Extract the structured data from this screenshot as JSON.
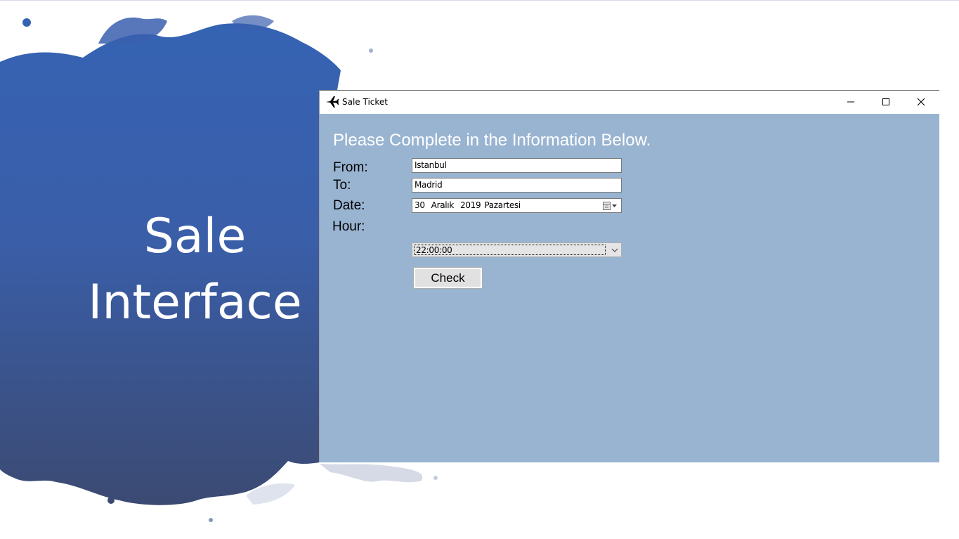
{
  "slide": {
    "title_line1": "Sale",
    "title_line2": "Interface"
  },
  "window": {
    "title": "Sale Ticket",
    "icon": "airplane-icon",
    "controls": [
      "minimize-icon",
      "maximize-icon",
      "close-icon"
    ]
  },
  "form": {
    "heading": "Please Complete in the Information Below.",
    "from_label": "From:",
    "from_value": "Istanbul",
    "to_label": "To:",
    "to_value": "Madrid",
    "date_label": "Date:",
    "date_day": "30",
    "date_month": "Aralık",
    "date_year": "2019",
    "date_weekday": "Pazartesi",
    "hour_label": "Hour:",
    "hour_value": "22:00:00",
    "check_label": "Check"
  },
  "colors": {
    "client_bg": "#99b4d1",
    "splash_blue_top": "#3563b3",
    "splash_blue_bottom": "#3b4d78",
    "heading_text": "#ffffff"
  }
}
